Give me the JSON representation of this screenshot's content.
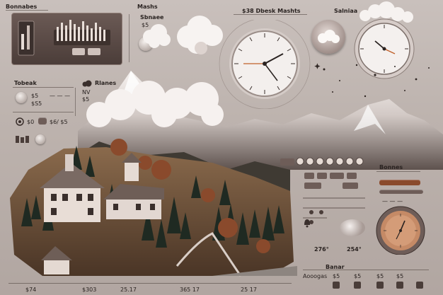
{
  "top": {
    "left_title": "Bonnabes",
    "center_left_title": "Mashs",
    "side_title": "Sbnaee",
    "side_value": "$5",
    "clock_header": "$38 Dbesk Mashts",
    "right_header": "Salniaa"
  },
  "left_panel": {
    "title": "Tobeak",
    "row1": "$5",
    "row2": "$S5",
    "dashes1": "— — —",
    "label_b": "$0",
    "stats": "$6/ $5"
  },
  "center_label": {
    "prefix": "NV",
    "title": "Rlanes",
    "sub": "$5"
  },
  "right_panel": {
    "title": "Bonnes",
    "ticker": "— — —"
  },
  "widget_values": {
    "left": "276°",
    "right": "254°"
  },
  "bottom_right": {
    "title": "Banar",
    "labels": [
      "Aooogas",
      "$5",
      "$5",
      "$5",
      "$5"
    ]
  },
  "bottom_axis": [
    "$74",
    "$303",
    "25.17",
    "365 17",
    "25 17"
  ],
  "colors": {
    "accent": "#6e5d58",
    "panel": "#574843",
    "clock_face": "#f3efed",
    "hand_accent": "#c0602a"
  },
  "icons": [
    "gear-icon",
    "bell-icon",
    "home-icon",
    "cloud-icon",
    "star-icon",
    "sun-icon"
  ]
}
